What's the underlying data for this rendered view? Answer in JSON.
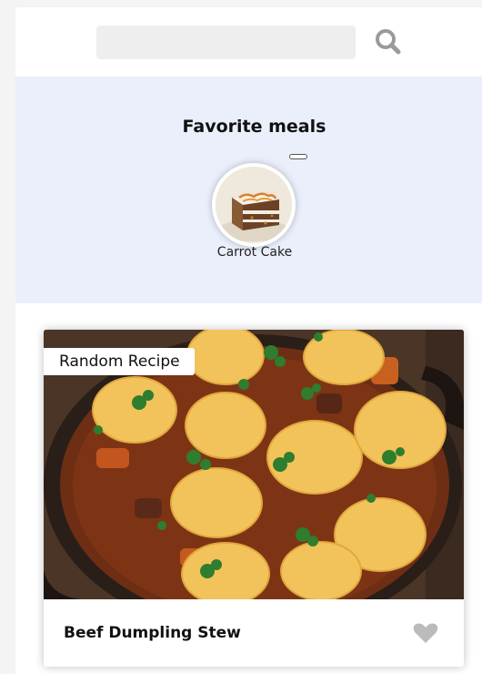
{
  "header": {
    "search": {
      "value": "",
      "placeholder": ""
    },
    "search_icon": "search-icon"
  },
  "favorites": {
    "title": "Favorite meals",
    "items": [
      {
        "name": "Carrot Cake",
        "image": "carrot-cake-photo"
      }
    ]
  },
  "meal": {
    "tag": "Random Recipe",
    "name": "Beef Dumpling Stew",
    "image": "beef-dumpling-stew-photo",
    "favorite_icon": "heart-icon",
    "favorite_active": false
  },
  "colors": {
    "favorites_bg": "#ebeffb",
    "search_bg": "#eeeeee",
    "icon_gray": "#9a9a9a",
    "heart_gray": "#bbbbbb"
  }
}
